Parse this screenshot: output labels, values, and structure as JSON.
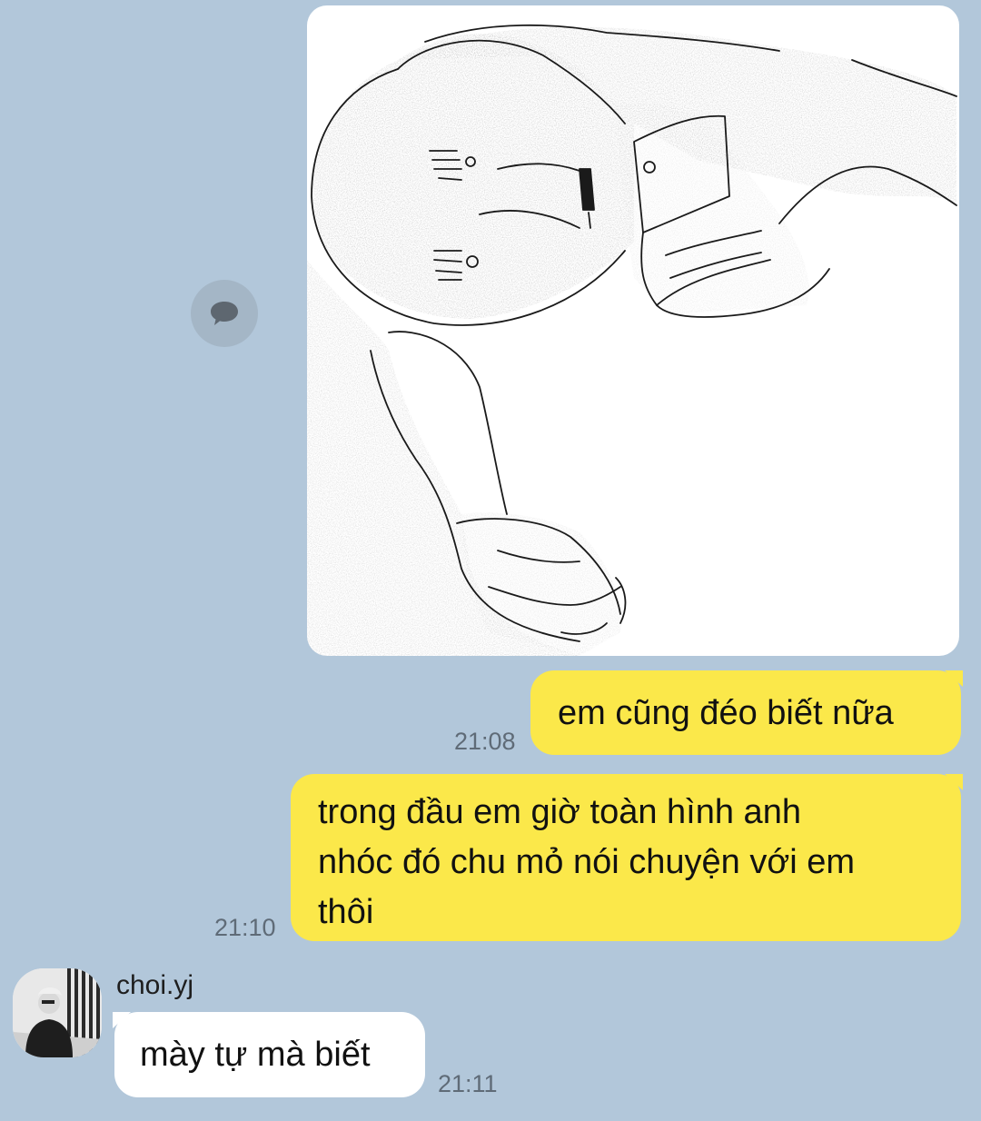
{
  "colors": {
    "background": "#b2c7da",
    "outgoing_bubble": "#fbe84a",
    "incoming_bubble": "#ffffff",
    "timestamp": "#5f6b77"
  },
  "icons": {
    "share": "speech-bubble-icon"
  },
  "messages": [
    {
      "direction": "outgoing",
      "type": "image",
      "content": "sketch of a figure holding a phone"
    },
    {
      "direction": "outgoing",
      "type": "text",
      "text": "em cũng đéo biết nữa",
      "time": "21:08"
    },
    {
      "direction": "outgoing",
      "type": "text",
      "lines": [
        "trong đầu em giờ toàn hình anh",
        "nhóc đó chu mỏ nói chuyện với em",
        "thôi"
      ],
      "time": "21:10"
    },
    {
      "direction": "incoming",
      "sender": "choi.yj",
      "type": "text",
      "text": "mày tự mà biết",
      "time": "21:11"
    }
  ]
}
